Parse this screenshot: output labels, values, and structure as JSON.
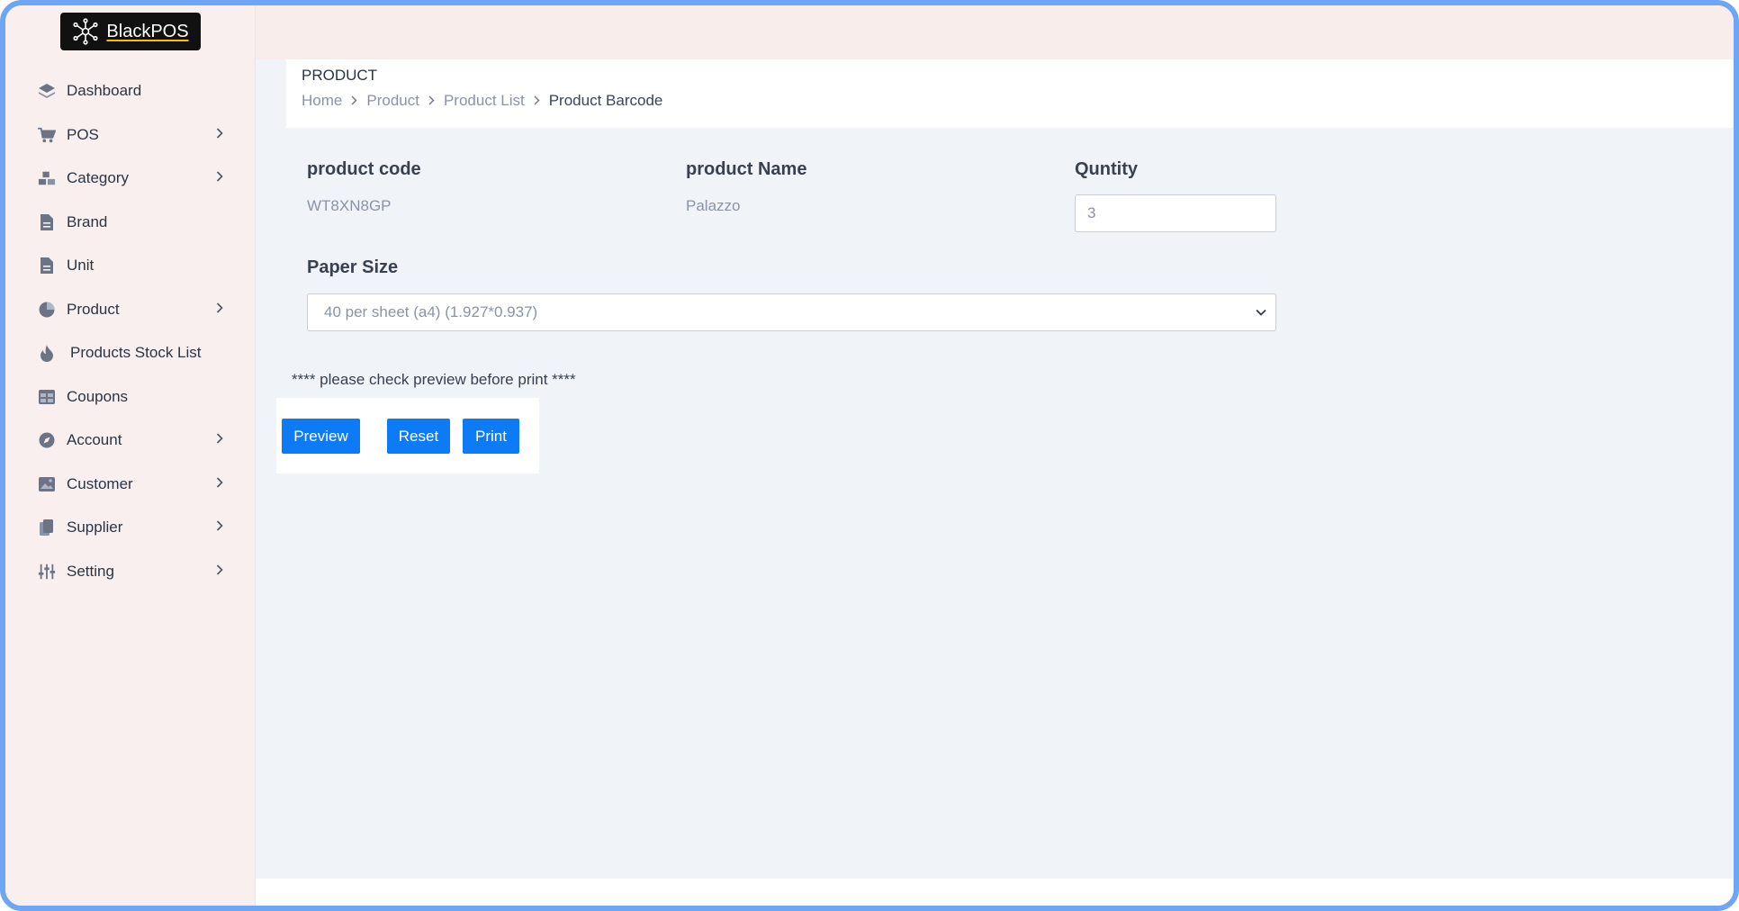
{
  "app": {
    "logo_text": "BlackPOS"
  },
  "sidebar": {
    "items": [
      {
        "label": "Dashboard",
        "icon": "layers-icon",
        "has_submenu": false
      },
      {
        "label": "POS",
        "icon": "cart-icon",
        "has_submenu": true
      },
      {
        "label": "Category",
        "icon": "boxes-icon",
        "has_submenu": true
      },
      {
        "label": "Brand",
        "icon": "file-icon",
        "has_submenu": false
      },
      {
        "label": "Unit",
        "icon": "file-icon",
        "has_submenu": false
      },
      {
        "label": "Product",
        "icon": "pie-chart-icon",
        "has_submenu": true
      },
      {
        "label": "Products Stock List",
        "icon": "fire-icon",
        "has_submenu": false
      },
      {
        "label": "Coupons",
        "icon": "table-icon",
        "has_submenu": false
      },
      {
        "label": "Account",
        "icon": "compass-icon",
        "has_submenu": true
      },
      {
        "label": "Customer",
        "icon": "image-icon",
        "has_submenu": true
      },
      {
        "label": "Supplier",
        "icon": "copy-icon",
        "has_submenu": true
      },
      {
        "label": "Setting",
        "icon": "sliders-icon",
        "has_submenu": true
      }
    ]
  },
  "header": {
    "title": "PRODUCT",
    "breadcrumb": [
      "Home",
      "Product",
      "Product List",
      "Product Barcode"
    ]
  },
  "form": {
    "product_code_label": "product code",
    "product_code_value": "WT8XN8GP",
    "product_name_label": "product Name",
    "product_name_value": "Palazzo",
    "quantity_label": "Quntity",
    "quantity_value": "3",
    "paper_size_label": "Paper Size",
    "paper_size_value": "40 per sheet (a4) (1.927*0.937)"
  },
  "note": "**** please check preview before print ****",
  "buttons": {
    "preview": "Preview",
    "reset": "Reset",
    "print": "Print"
  },
  "colors": {
    "accent": "#0d7bf6",
    "sidebar_bg": "#f8efee",
    "content_bg": "#f0f3f8"
  }
}
